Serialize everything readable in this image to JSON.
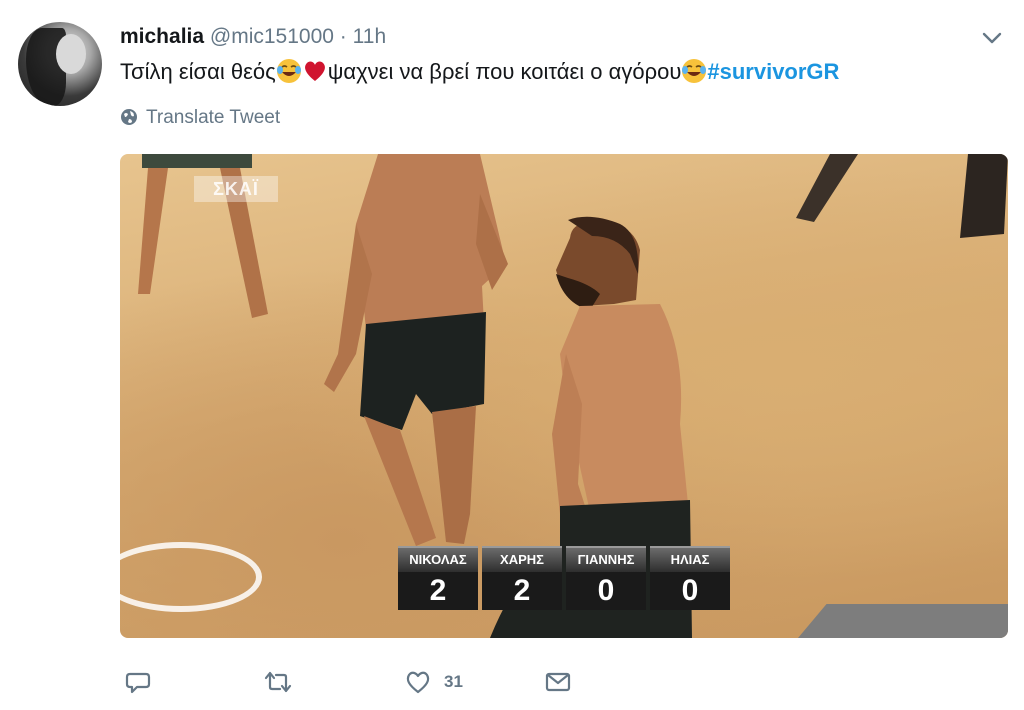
{
  "tweet": {
    "display_name": "michalia",
    "handle": "@mic151000",
    "separator": "·",
    "time": "11h",
    "text_part1": "Τσίλη είσαι θεός",
    "text_part2": "ψαχνει να βρεί που κοιτάει ο αγόρου",
    "hashtag": "#survivorGR",
    "emojis": [
      "face-with-tears-of-joy",
      "red-heart",
      "face-with-tears-of-joy"
    ],
    "translate_label": "Translate Tweet",
    "like_count": "31"
  },
  "media": {
    "channel_logo": "ΣΚΑΪ",
    "scoreboard": [
      {
        "name": "ΝΙΚΟΛΑΣ",
        "score": "2"
      },
      {
        "name": "ΧΑΡΗΣ",
        "score": "2"
      },
      {
        "name": "ΓΙΑΝΝΗΣ",
        "score": "0"
      },
      {
        "name": "ΗΛΙΑΣ",
        "score": "0"
      }
    ]
  },
  "colors": {
    "link": "#1b95e0",
    "text": "#14171a",
    "secondary": "#657786"
  },
  "icons": [
    "caret-down-icon",
    "globe-icon",
    "reply-icon",
    "retweet-icon",
    "like-icon",
    "direct-message-icon"
  ]
}
